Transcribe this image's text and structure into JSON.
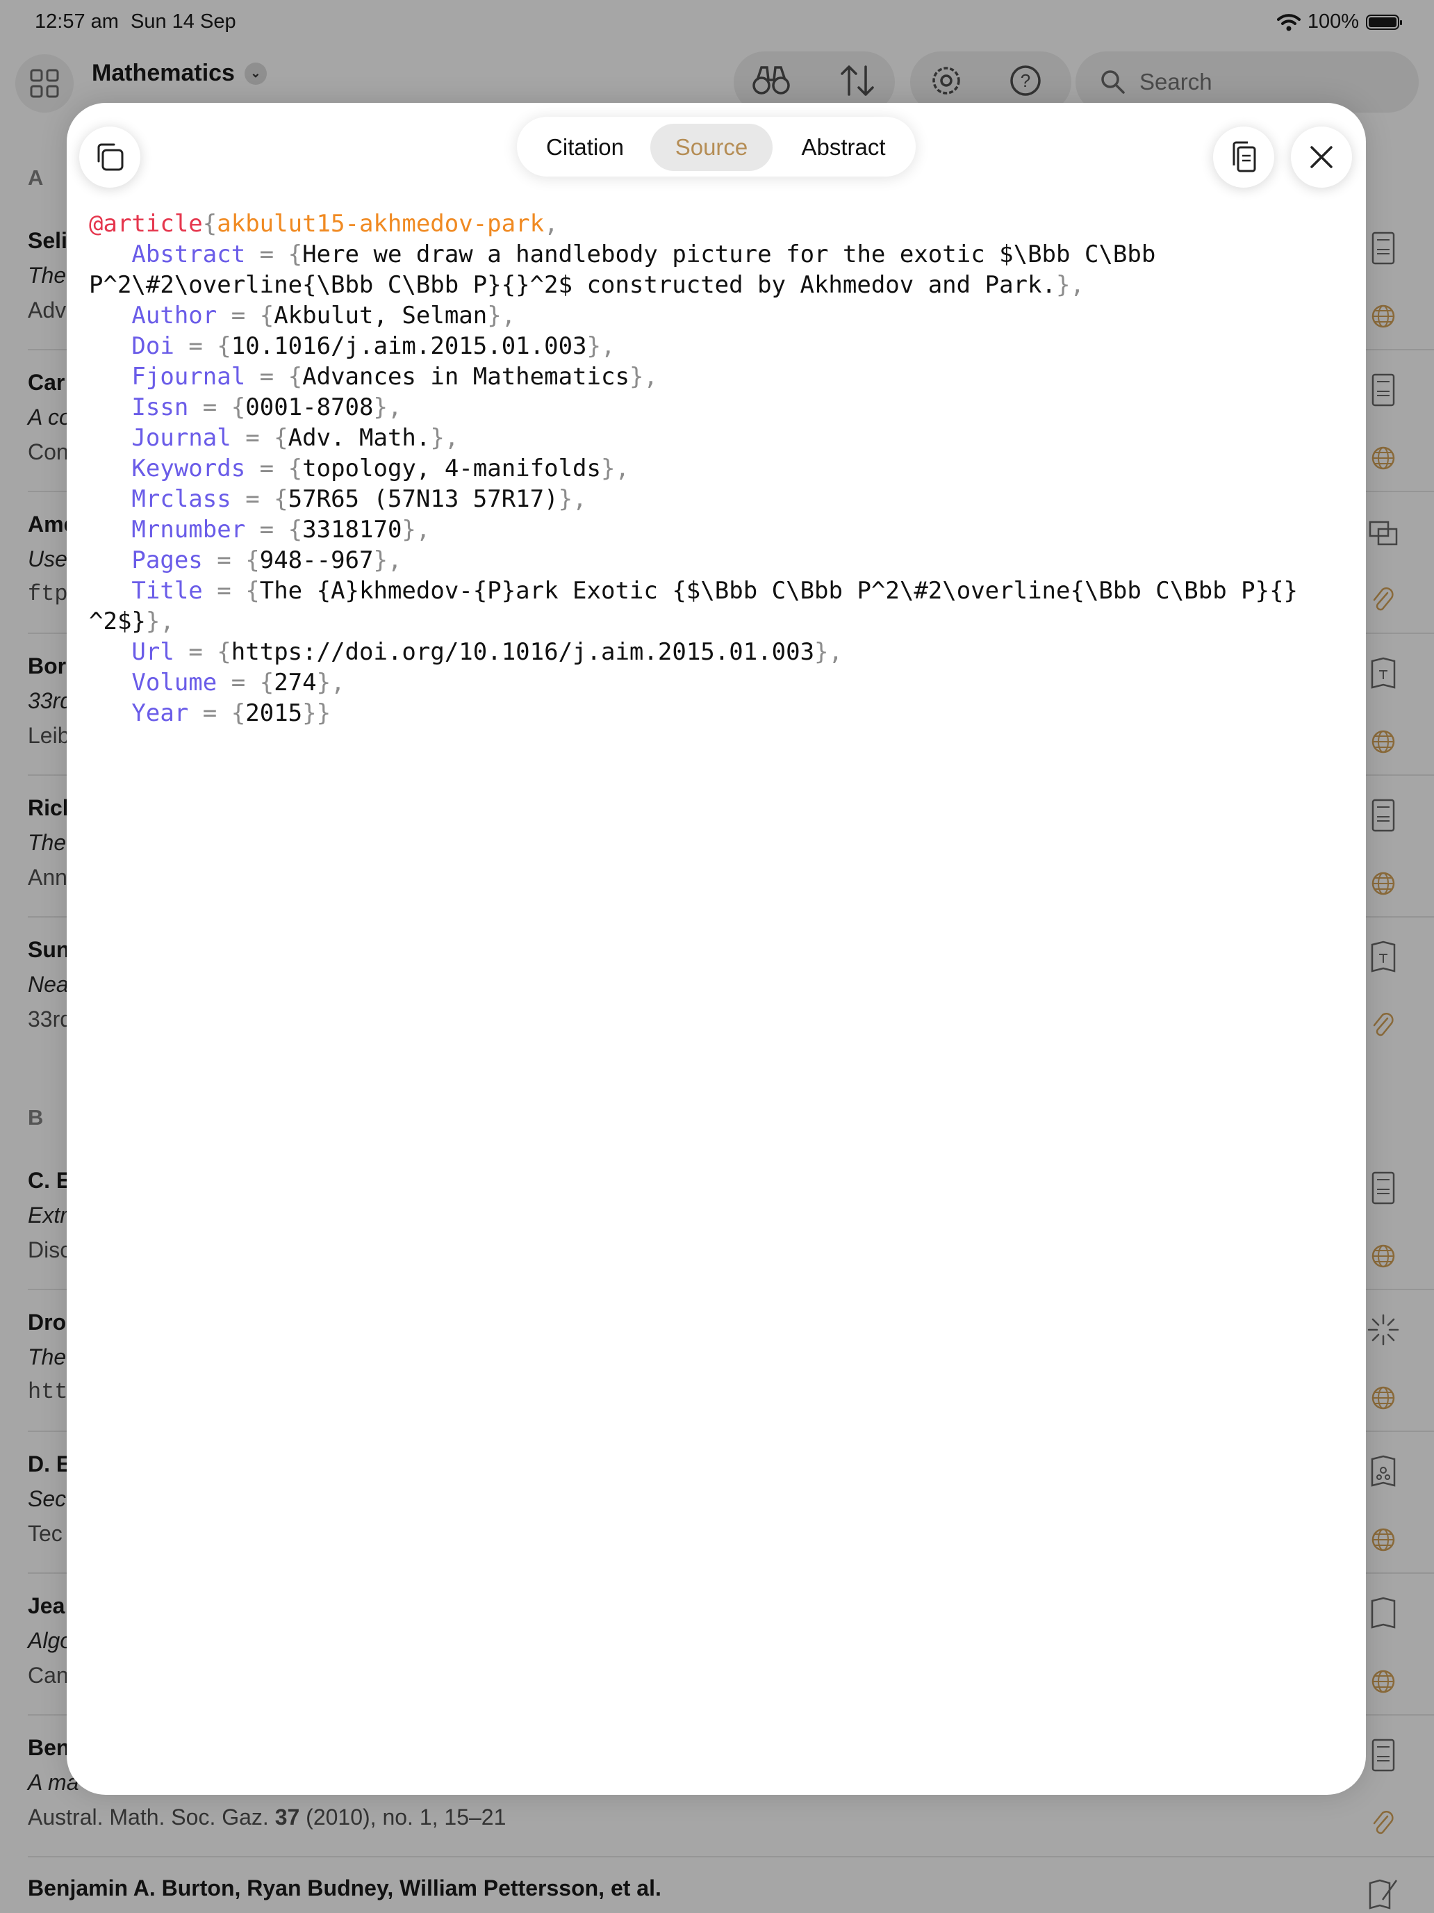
{
  "status_bar": {
    "time": "12:57 am",
    "date": "Sun 14 Sep",
    "battery": "100%"
  },
  "toolbar": {
    "library_title": "Mathematics",
    "search_placeholder": "Search",
    "icons": [
      "grid-icon",
      "binoculars-icon",
      "sort-icon",
      "settings-icon",
      "help-icon",
      "search-icon"
    ]
  },
  "background_list": {
    "sections": [
      "A",
      "B"
    ],
    "rows": [
      {
        "l1": "Seli",
        "l2": "The",
        "l3": "Adv"
      },
      {
        "l1": "Car",
        "l2": "A co",
        "l3": "Con"
      },
      {
        "l1": "Ame",
        "l2": "Use",
        "l3": "ftp"
      },
      {
        "l1": "Bor",
        "l2": "33rd",
        "l3": "Leib"
      },
      {
        "l1": "Rich",
        "l2": "The",
        "l3": "Ann"
      },
      {
        "l1": "Sun",
        "l2": "Nea",
        "l3": "33rd"
      },
      {
        "l1": "C. E",
        "l2": "Extr",
        "l3": "Disc"
      },
      {
        "l1": "Dro",
        "l2": "The",
        "l3": "htt"
      },
      {
        "l1": "D. E",
        "l2": "Sec",
        "l3": "Tec"
      },
      {
        "l1": "Jea",
        "l2": "Algo",
        "l3": "Can"
      },
      {
        "l1": "Ben",
        "l2": "A ma",
        "l3_a": "Austral. Math. Soc. Gaz. ",
        "l3_b": "37",
        "l3_c": " (2010), no. 1, 15–21"
      },
      {
        "l1": "Benjamin A. Burton, Ryan Budney, William Pettersson, et al."
      }
    ]
  },
  "modal": {
    "tabs": [
      {
        "label": "Citation",
        "selected": false
      },
      {
        "label": "Source",
        "selected": true
      },
      {
        "label": "Abstract",
        "selected": false
      }
    ],
    "accent_color": "#b58d55",
    "entry_type": "@article",
    "cite_key": "akbulut15-akhmedov-park",
    "fields": [
      {
        "name": "Abstract",
        "value_lines": [
          "Here we draw a handlebody picture for the exotic $\\Bbb C\\Bbb",
          "P^2\\#2\\overline{\\Bbb C\\Bbb P}{}^2$ constructed by Akhmedov and Park."
        ]
      },
      {
        "name": "Author",
        "value_lines": [
          "Akbulut, Selman"
        ]
      },
      {
        "name": "Doi",
        "value_lines": [
          "10.1016/j.aim.2015.01.003"
        ]
      },
      {
        "name": "Fjournal",
        "value_lines": [
          "Advances in Mathematics"
        ]
      },
      {
        "name": "Issn",
        "value_lines": [
          "0001-8708"
        ]
      },
      {
        "name": "Journal",
        "value_lines": [
          "Adv. Math."
        ]
      },
      {
        "name": "Keywords",
        "value_lines": [
          "topology, 4-manifolds"
        ]
      },
      {
        "name": "Mrclass",
        "value_lines": [
          "57R65 (57N13 57R17)"
        ]
      },
      {
        "name": "Mrnumber",
        "value_lines": [
          "3318170"
        ]
      },
      {
        "name": "Pages",
        "value_lines": [
          "948--967"
        ]
      },
      {
        "name": "Title",
        "value_lines": [
          "The {A}khmedov-{P}ark Exotic {$\\Bbb C\\Bbb P^2\\#2\\overline{\\Bbb C\\Bbb P}{}",
          "^2$}"
        ]
      },
      {
        "name": "Url",
        "value_lines": [
          "https://doi.org/10.1016/j.aim.2015.01.003"
        ]
      },
      {
        "name": "Volume",
        "value_lines": [
          "274"
        ]
      },
      {
        "name": "Year",
        "value_lines": [
          "2015"
        ]
      }
    ]
  }
}
